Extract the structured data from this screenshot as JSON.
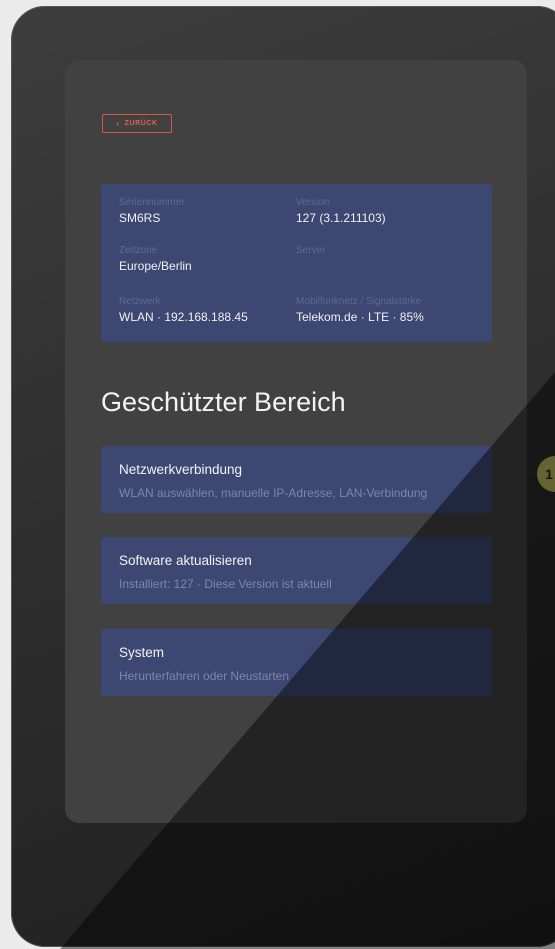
{
  "back": {
    "label": "ZURÜCK",
    "icon": "chevron-left-icon"
  },
  "info": {
    "serial": {
      "label": "Seriennummer",
      "value": "SM6RS"
    },
    "version": {
      "label": "Version",
      "value": "127 (3.1.211103)"
    },
    "timezone": {
      "label": "Zeitzone",
      "value": "Europe/Berlin"
    },
    "server": {
      "label": "Server",
      "value": ""
    },
    "network": {
      "label": "Netzwerk",
      "value": "WLAN · 192.168.188.45"
    },
    "mobile": {
      "label": "Mobilfunknetz / Signalstärke",
      "value": "Telekom.de · LTE · 85%"
    }
  },
  "section_title": "Geschützter Bereich",
  "cards": [
    {
      "title": "Netzwerkverbindung",
      "subtitle": "WLAN auswählen, manuelle IP-Adresse, LAN-Verbindung"
    },
    {
      "title": "Software aktualisieren",
      "subtitle": "Installiert: 127 · Diese Version ist aktuell"
    },
    {
      "title": "System",
      "subtitle": "Herunterfahren oder Neustarten"
    }
  ],
  "badge": {
    "text": "1"
  },
  "colors": {
    "accent": "#e0634e",
    "panel": "#3c4772",
    "badge": "#b6b45a"
  }
}
